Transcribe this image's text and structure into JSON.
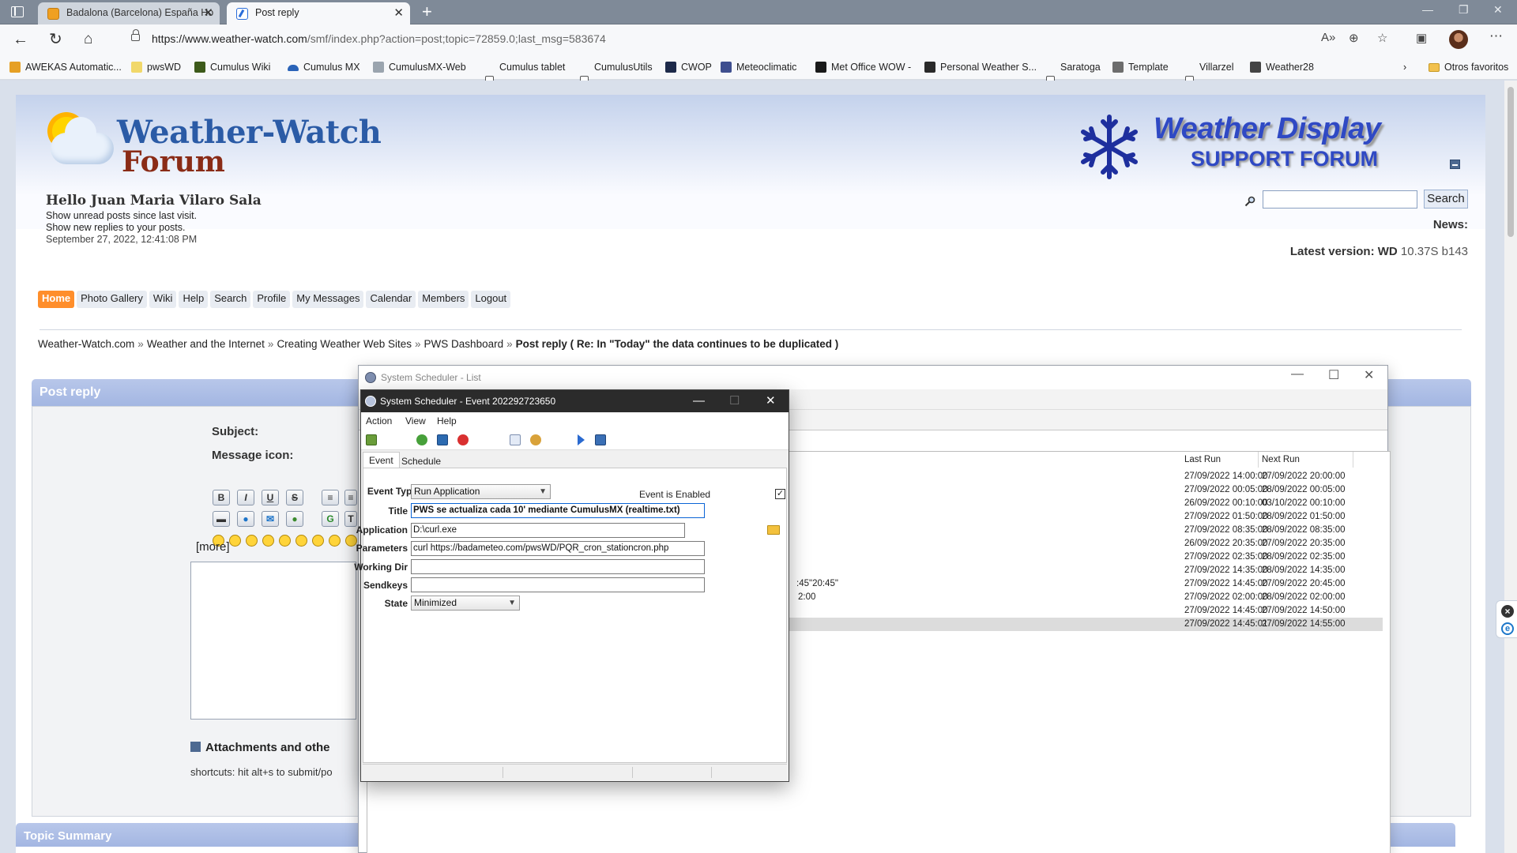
{
  "browser": {
    "tabs": [
      {
        "title": "Badalona (Barcelona) España Ho",
        "active": false
      },
      {
        "title": "Post reply",
        "active": true
      }
    ],
    "url_host": "https://www.weather-watch.com",
    "url_path": "/smf/index.php?action=post;topic=72859.0;last_msg=583674",
    "bookmarks": [
      "AWEKAS Automatic...",
      "pwsWD",
      "Cumulus Wiki",
      "Cumulus MX",
      "CumulusMX-Web",
      "Cumulus tablet",
      "CumulusUtils",
      "CWOP",
      "Meteoclimatic",
      "Met Office WOW -",
      "Personal Weather S...",
      "Saratoga",
      "Template",
      "Villarzel",
      "Weather28"
    ],
    "other_favorites": "Otros favoritos"
  },
  "forum": {
    "logo_title": "Weather-Watch",
    "logo_sub": "Forum",
    "wd_title": "Weather Display",
    "wd_sub": "SUPPORT FORUM",
    "greeting": "Hello Juan Maria Vilaro Sala",
    "unread": "Show unread posts since last visit.",
    "replies": "Show new replies to your posts.",
    "datetime": "September 27, 2022, 12:41:08 PM",
    "search_button": "Search",
    "news_label": "News:",
    "latest_prefix": "Latest version:",
    "latest_wd": "WD",
    "latest_version": "10.37S b143",
    "menu": [
      "Home",
      "Photo Gallery",
      "Wiki",
      "Help",
      "Search",
      "Profile",
      "My Messages",
      "Calendar",
      "Members",
      "Logout"
    ],
    "breadcrumbs": [
      "Weather-Watch.com",
      "Weather and the Internet",
      "Creating Weather Web Sites",
      "PWS Dashboard"
    ],
    "crumb_last_bold": "Post reply",
    "crumb_last_rest": "( Re: In \"Today\" the data continues to be duplicated )",
    "post_reply_header": "Post reply",
    "subject_label": "Subject:",
    "icon_label": "Message icon:",
    "more": "[more]",
    "attachments": "Attachments and othe",
    "shortcuts": "shortcuts: hit alt+s to submit/po",
    "topic_summary": "Topic Summary",
    "format_buttons": [
      "B",
      "I",
      "U",
      "S",
      "≡",
      "≡"
    ]
  },
  "list_window": {
    "title": "System Scheduler - List",
    "col_last_run": "Last Run",
    "col_next_run": "Next Run",
    "rows": [
      {
        "extra": "",
        "last": "27/09/2022 14:00:00",
        "next": "27/09/2022 20:00:00"
      },
      {
        "extra": "",
        "last": "27/09/2022 00:05:00",
        "next": "28/09/2022 00:05:00"
      },
      {
        "extra": "",
        "last": "26/09/2022 00:10:00",
        "next": "03/10/2022 00:10:00"
      },
      {
        "extra": "",
        "last": "27/09/2022 01:50:00",
        "next": "28/09/2022 01:50:00"
      },
      {
        "extra": "",
        "last": "27/09/2022 08:35:00",
        "next": "28/09/2022 08:35:00"
      },
      {
        "extra": "",
        "last": "26/09/2022 20:35:00",
        "next": "27/09/2022 20:35:00"
      },
      {
        "extra": "",
        "last": "27/09/2022 02:35:00",
        "next": "28/09/2022 02:35:00"
      },
      {
        "extra": "",
        "last": "27/09/2022 14:35:00",
        "next": "28/09/2022 14:35:00"
      },
      {
        "extra": ":45\"20:45\"",
        "last": "27/09/2022 14:45:00",
        "next": "27/09/2022 20:45:00"
      },
      {
        "extra": "2:00",
        "last": "27/09/2022 02:00:00",
        "next": "28/09/2022 02:00:00"
      },
      {
        "extra": "",
        "last": "27/09/2022 14:45:00",
        "next": "27/09/2022 14:50:00"
      },
      {
        "extra": "",
        "last": "27/09/2022 14:45:01",
        "next": "27/09/2022 14:55:00"
      }
    ]
  },
  "event_window": {
    "title": "System Scheduler - Event 202292723650",
    "menu": [
      "Action",
      "View",
      "Help"
    ],
    "tab_event": "Event",
    "tab_schedule": "Schedule",
    "lbl_event_type": "Event Type",
    "event_type": "Run Application",
    "enabled_label": "Event is Enabled",
    "enabled_mark": "✓",
    "lbl_title": "Title",
    "title_value": "PWS se actualiza cada 10' mediante CumulusMX (realtime.txt)",
    "lbl_application": "Application",
    "application": "D:\\curl.exe",
    "lbl_parameters": "Parameters",
    "parameters": "curl https://badameteo.com/pwsWD/PQR_cron_stationcron.php",
    "lbl_working_dir": "Working Dir",
    "working_dir": "",
    "lbl_sendkeys": "Sendkeys",
    "sendkeys": "",
    "lbl_state": "State",
    "state": "Minimized"
  }
}
